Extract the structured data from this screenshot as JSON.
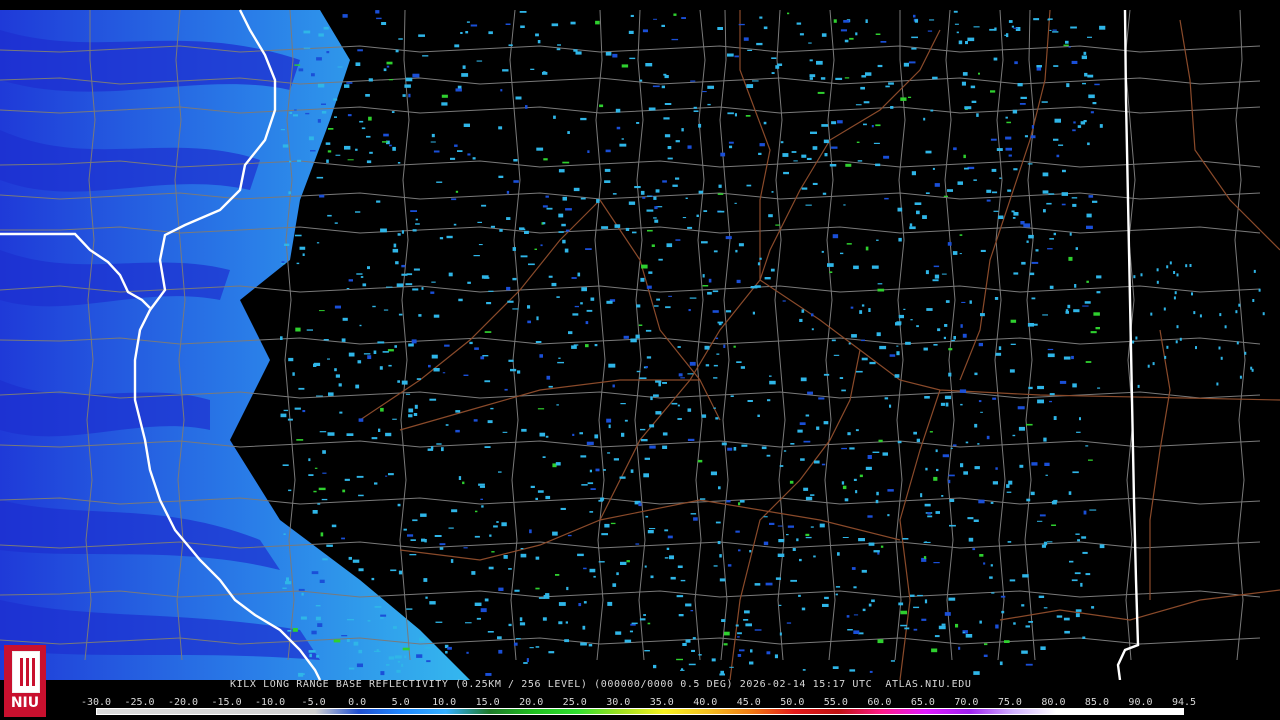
{
  "header": {
    "caption": "KILX LONG RANGE BASE REFLECTIVITY (0.25KM / 256 LEVEL) (000000/0000 0.5 DEG) 2026-02-14 15:17 UTC  ATLAS.NIU.EDU"
  },
  "logo": {
    "text": "NIU",
    "icon": "niu-tower-icon"
  },
  "colorbar": {
    "labels": [
      "-30.0",
      "-25.0",
      "-20.0",
      "-15.0",
      "-10.0",
      "-5.0",
      "0.0",
      "5.0",
      "10.0",
      "15.0",
      "20.0",
      "25.0",
      "30.0",
      "35.0",
      "40.0",
      "45.0",
      "50.0",
      "55.0",
      "60.0",
      "65.0",
      "70.0",
      "75.0",
      "80.0",
      "85.0",
      "90.0",
      "94.5"
    ],
    "stops": [
      {
        "value": -30,
        "color": "#d9d9d9"
      },
      {
        "value": -5,
        "color": "#cfcfcf"
      },
      {
        "value": 0,
        "color": "#1f4fd0"
      },
      {
        "value": 5,
        "color": "#1f88ff"
      },
      {
        "value": 10,
        "color": "#33b0ff"
      },
      {
        "value": 15,
        "color": "#1e7b2a"
      },
      {
        "value": 20,
        "color": "#1fbf1f"
      },
      {
        "value": 25,
        "color": "#2fe02f"
      },
      {
        "value": 30,
        "color": "#9fe01f"
      },
      {
        "value": 35,
        "color": "#f6f21f"
      },
      {
        "value": 40,
        "color": "#f3c01f"
      },
      {
        "value": 45,
        "color": "#f07a12"
      },
      {
        "value": 50,
        "color": "#e41a1a"
      },
      {
        "value": 55,
        "color": "#c01212"
      },
      {
        "value": 60,
        "color": "#ff1a8a"
      },
      {
        "value": 65,
        "color": "#e01aff"
      },
      {
        "value": 70,
        "color": "#a020f0"
      },
      {
        "value": 75,
        "color": "#d0b0ff"
      },
      {
        "value": 80,
        "color": "#ffffff"
      },
      {
        "value": 94.5,
        "color": "#ffffff"
      }
    ]
  },
  "map_colors": {
    "background": "#000000",
    "county_lines": "#7a7a7a",
    "state_lines": "#ffffff",
    "highways": "#8a4a2a",
    "clutter_light": "#2fb6e8",
    "clutter_dark": "#1a4fd8",
    "clutter_green": "#2fd02f"
  }
}
